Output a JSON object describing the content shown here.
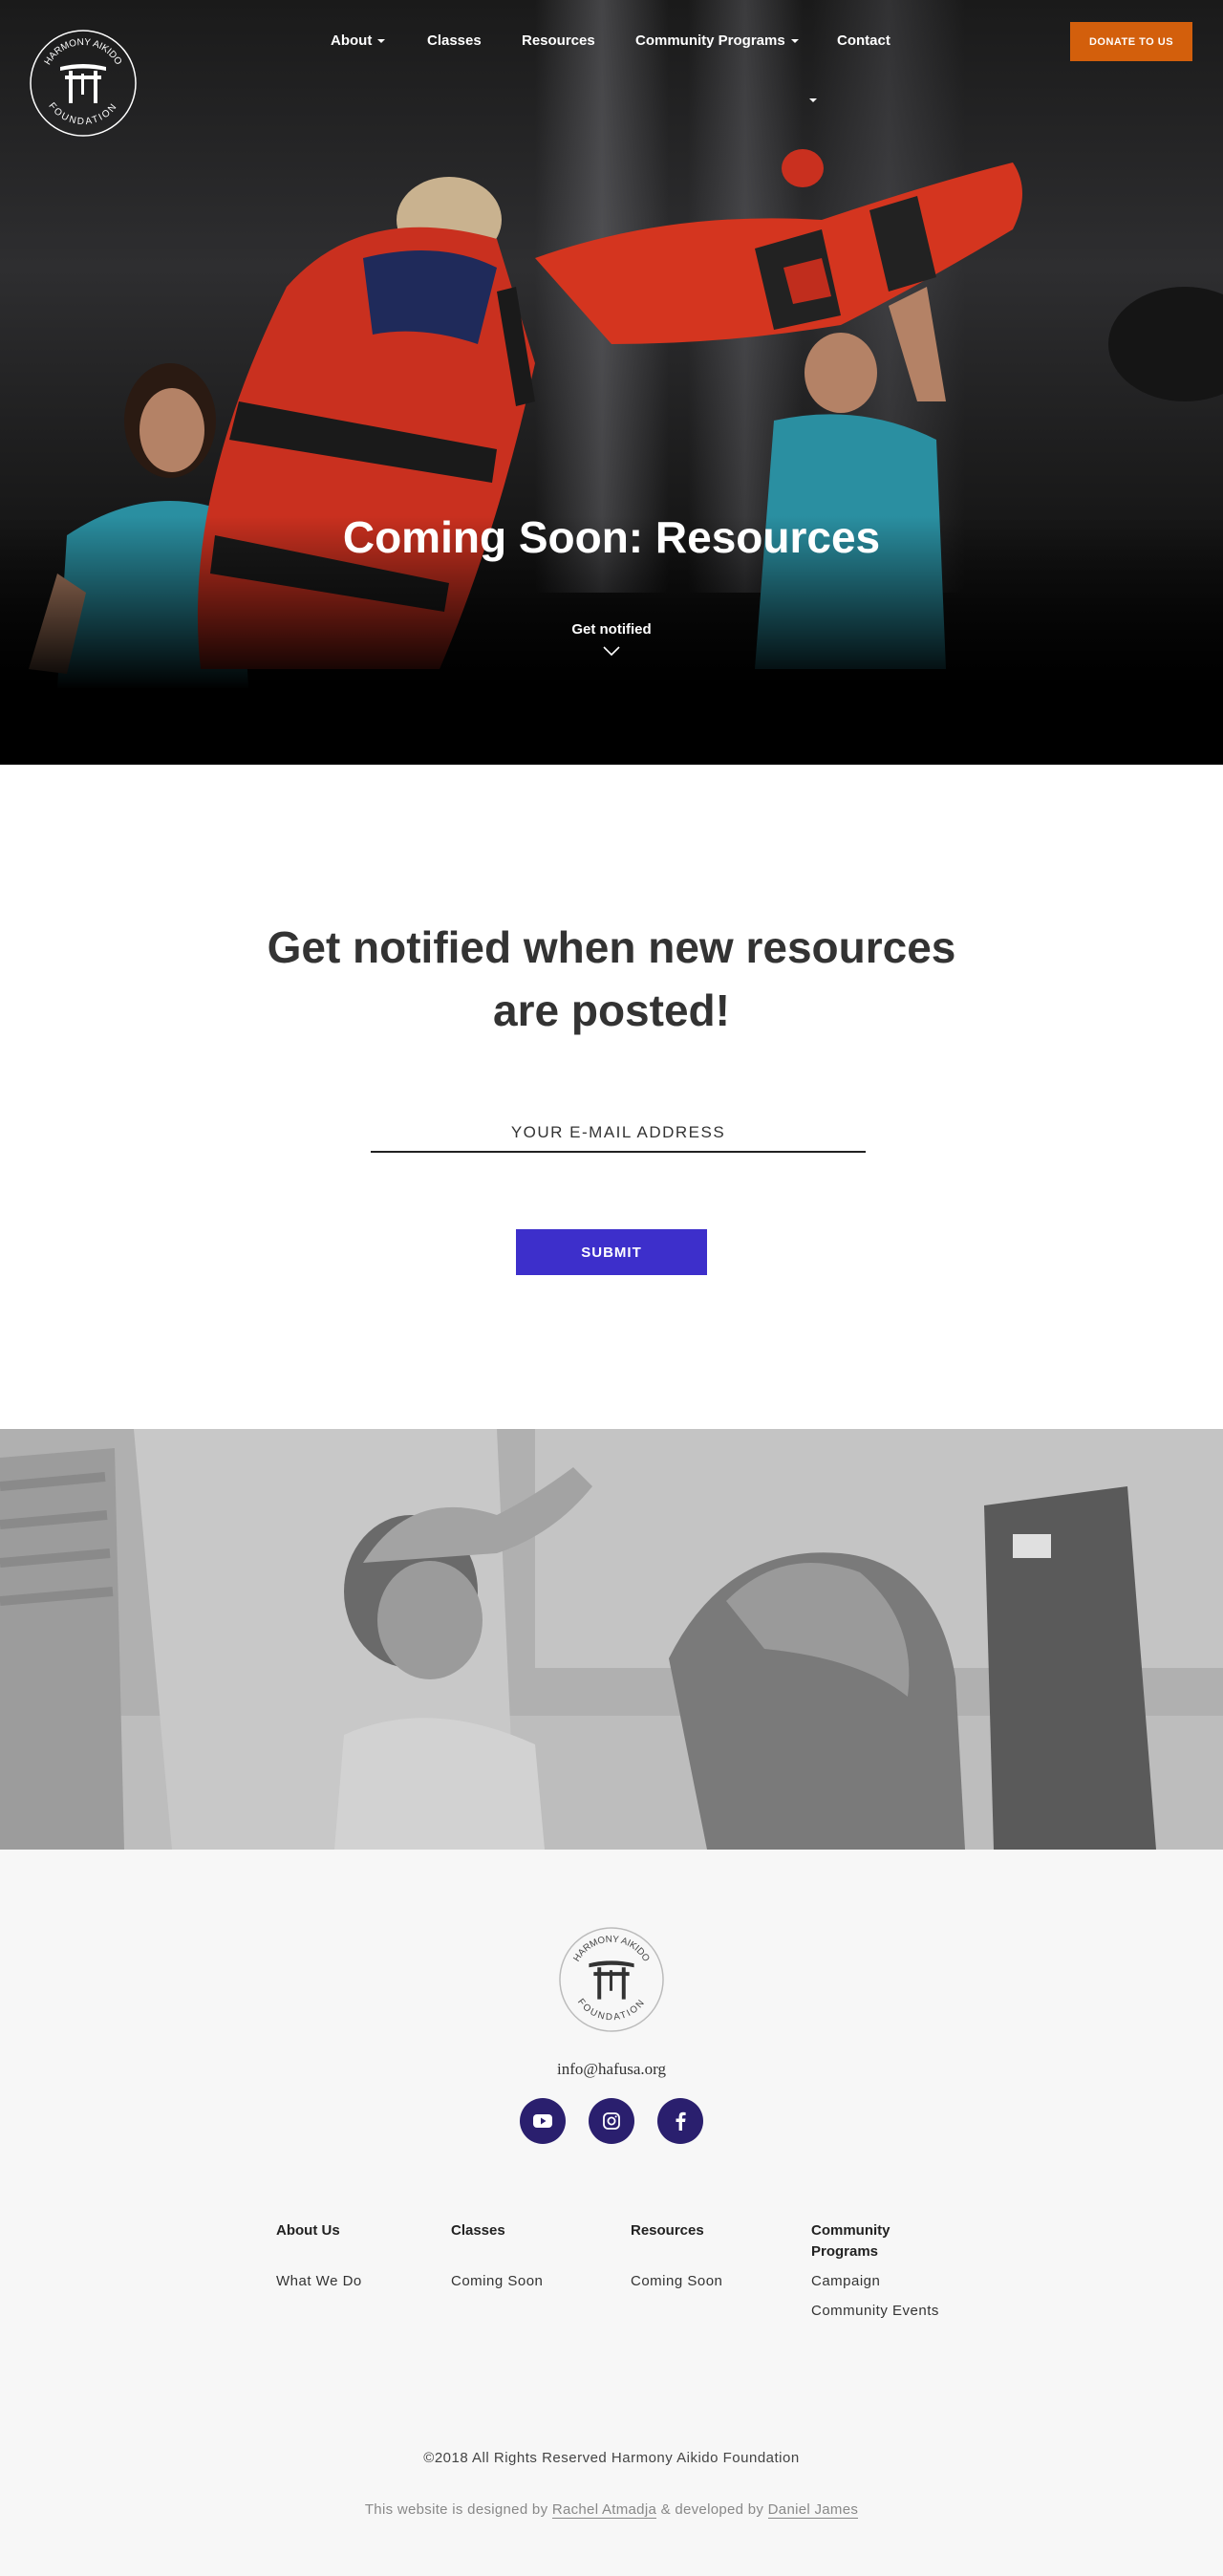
{
  "brand": {
    "logo_top_text": "HARMONY AIKIDO",
    "logo_bottom_text": "FOUNDATION"
  },
  "nav": {
    "items": [
      {
        "label": "About",
        "has_dropdown": true
      },
      {
        "label": "Classes",
        "has_dropdown": false
      },
      {
        "label": "Resources",
        "has_dropdown": false
      },
      {
        "label": "Community Programs",
        "has_dropdown": true
      },
      {
        "label": "Contact",
        "has_dropdown": false
      }
    ],
    "donate_label": "DONATE TO US"
  },
  "hero": {
    "title": "Coming Soon: Resources",
    "subtitle": "Get notified"
  },
  "notify": {
    "title": "Get notified when new resources are posted!",
    "email_placeholder": "YOUR E-MAIL ADDRESS",
    "submit_label": "SUBMIT"
  },
  "footer": {
    "email": "info@hafusa.org",
    "social": [
      "youtube-icon",
      "instagram-icon",
      "facebook-icon"
    ],
    "columns": [
      {
        "heading": "About Us",
        "links": [
          "What We Do"
        ]
      },
      {
        "heading": "Classes",
        "links": [
          "Coming Soon"
        ]
      },
      {
        "heading": "Resources",
        "links": [
          "Coming Soon"
        ]
      },
      {
        "heading": "Community Programs",
        "links": [
          "Campaign",
          "Community Events"
        ]
      }
    ],
    "copyright": "©2018  All Rights Reserved  Harmony Aikido Foundation",
    "credits_prefix": "This website is designed by",
    "designer": "Rachel Atmadja",
    "credits_middle": "& developed by",
    "developer": "Daniel James"
  },
  "colors": {
    "donate": "#d35f0c",
    "submit": "#3d2fcb",
    "social_bg": "#2a1f6e"
  }
}
